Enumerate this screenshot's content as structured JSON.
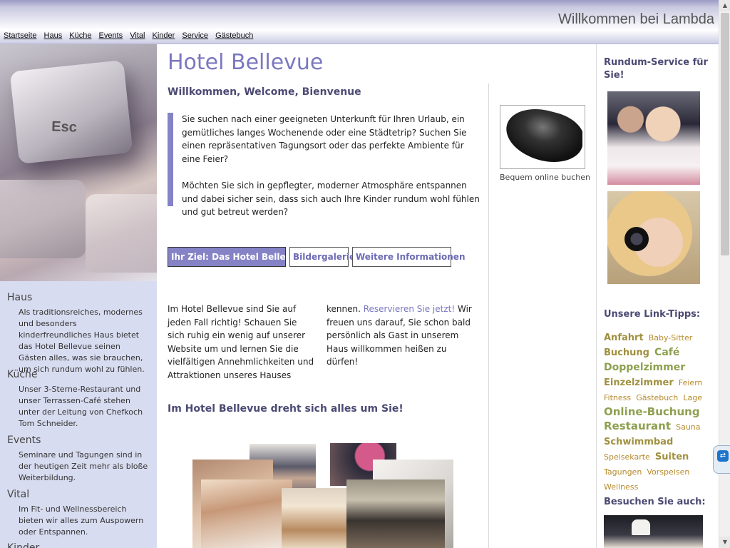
{
  "header": {
    "site_title": "Willkommen bei Lambda",
    "nav": [
      "Startseite",
      "Haus",
      "Küche",
      "Events",
      "Vital",
      "Kinder",
      "Service",
      "Gästebuch"
    ]
  },
  "left": {
    "image_label": "Esc",
    "sections": [
      {
        "title": "Haus",
        "text": "Als traditionsreiches, modernes und besonders kinderfreundliches Haus bietet das Hotel Bellevue seinen Gästen alles, was sie brauchen, um sich rundum wohl zu fühlen."
      },
      {
        "title": "Küche",
        "text": "Unser 3-Sterne-Restaurant und unser Terrassen-Café stehen unter der Leitung von Chefkoch Tom Schneider."
      },
      {
        "title": "Events",
        "text": "Seminare und Tagungen sind in der heutigen Zeit mehr als bloße Weiterbildung."
      },
      {
        "title": "Vital",
        "text": "Im Fit- und Wellnessbereich bieten wir alles zum Auspowern oder Entspannen."
      },
      {
        "title": "Kinder",
        "text": ""
      }
    ]
  },
  "main": {
    "title": "Hotel Bellevue",
    "welcome": "Willkommen, Welcome, Bienvenue",
    "quote_p1": "Sie suchen nach einer geeigneten Unterkunft für Ihren Urlaub, ein gemütliches langes Wochenende oder eine Städtetrip? Suchen Sie einen repräsentativen Tagungsort oder das perfekte Ambiente für eine Feier?",
    "quote_p2": "Möchten Sie sich in gepflegter, moderner Atmosphäre entspannen und dabei sicher sein, dass sich auch Ihre Kinder rundum wohl fühlen und gut betreut werden?",
    "mouse_caption": "Bequem online buchen",
    "tabs": [
      "Ihr Ziel: Das Hotel Bellevue",
      "Bildergalerie",
      "Weitere Informationen"
    ],
    "body_text_1": "Im Hotel Bellevue sind Sie auf jeden Fall richtig! Schauen Sie sich ruhig ein wenig auf unserer Website um und lernen Sie die vielfältigen Annehmlichkeiten und Attraktionen unseres Hauses kennen. ",
    "body_link": "Reservieren Sie jetzt!",
    "body_text_2": " Wir freuen uns darauf, Sie schon bald persönlich als Gast in unserem Haus willkommen heißen zu dürfen!",
    "subheading": "Im Hotel Bellevue dreht sich alles um Sie!"
  },
  "right": {
    "service_heading": "Rundum-Service für Sie!",
    "link_tips_heading": "Unsere Link-Tipps:",
    "tags": [
      {
        "label": "Anfahrt",
        "size": "md"
      },
      {
        "label": "Baby-Sitter",
        "size": "sm"
      },
      {
        "label": "Buchung",
        "size": "md"
      },
      {
        "label": "Café",
        "size": "lg"
      },
      {
        "label": "Doppelzimmer",
        "size": "lg"
      },
      {
        "label": "Einzelzimmer",
        "size": "md"
      },
      {
        "label": "Feiern",
        "size": "sm"
      },
      {
        "label": "Fitness",
        "size": "sm"
      },
      {
        "label": "Gästebuch",
        "size": "sm"
      },
      {
        "label": "Lage",
        "size": "sm"
      },
      {
        "label": "Online-Buchung",
        "size": "xl"
      },
      {
        "label": "Restaurant",
        "size": "xl"
      },
      {
        "label": "Sauna",
        "size": "sm"
      },
      {
        "label": "Schwimmbad",
        "size": "md"
      },
      {
        "label": "Speisekarte",
        "size": "sm"
      },
      {
        "label": "Suiten",
        "size": "md"
      },
      {
        "label": "Tagungen",
        "size": "sm"
      },
      {
        "label": "Vorspeisen",
        "size": "sm"
      },
      {
        "label": "Wellness",
        "size": "sm"
      }
    ],
    "visit_heading": "Besuchen Sie auch:"
  },
  "colors": {
    "accent": "#8583c6",
    "heading": "#4c4a73",
    "left_bg": "#d8dcf0",
    "tag_gold": "#b08a3a",
    "tag_green": "#8ea050"
  },
  "icons": [
    "teamviewer-icon",
    "scroll-up-icon",
    "scroll-down-icon"
  ]
}
